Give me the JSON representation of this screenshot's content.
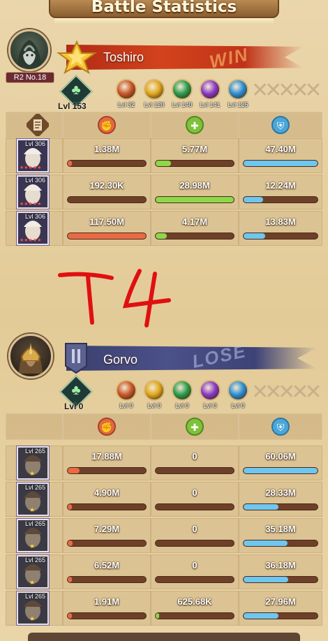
{
  "title": "Battle Statistics",
  "colors": {
    "damage": "#ea6a45",
    "heal": "#8cd84a",
    "defense": "#6fc6ee",
    "win_banner": "#c03218",
    "lose_banner": "#4b5189",
    "annotation": "#e01010"
  },
  "annotation": "T4",
  "teams": [
    {
      "player": "Toshiro",
      "rank": "R2 No.18",
      "result": "WIN",
      "level": "Lvl 153",
      "gems": [
        {
          "label": "Lvl 32",
          "color": "#c9582a",
          "icon": "fire-gem-icon"
        },
        {
          "label": "Lvl 120",
          "color": "#e1a81e",
          "icon": "shield-gem-icon"
        },
        {
          "label": "Lvl 140",
          "color": "#2e9b4c",
          "icon": "leaf-gem-icon"
        },
        {
          "label": "Lvl 141",
          "color": "#8a3bc4",
          "icon": "arcane-gem-icon"
        },
        {
          "label": "Lvl 125",
          "color": "#2f8fd2",
          "icon": "ice-gem-icon"
        }
      ],
      "heroes": [
        {
          "level": "Lvl 306",
          "stars": "★★★★★",
          "damage": "1.38M",
          "heal": "5.77M",
          "defense": "47.40M",
          "dmg_frac": 0.01,
          "heal_frac": 0.2,
          "def_frac": 1.0
        },
        {
          "level": "Lvl 306",
          "stars": "★★★★★",
          "damage": "192.30K",
          "heal": "28.98M",
          "defense": "12.24M",
          "dmg_frac": 0.0,
          "heal_frac": 1.0,
          "def_frac": 0.26
        },
        {
          "level": "Lvl 306",
          "stars": "★★★★★",
          "damage": "117.50M",
          "heal": "4.17M",
          "defense": "13.83M",
          "dmg_frac": 1.0,
          "heal_frac": 0.14,
          "def_frac": 0.29
        }
      ]
    },
    {
      "player": "Gorvo",
      "rank": "",
      "result": "LOSE",
      "level": "Lvl 0",
      "gems": [
        {
          "label": "Lvl 0",
          "color": "#c9582a",
          "icon": "fire-gem-icon"
        },
        {
          "label": "Lvl 0",
          "color": "#e1a81e",
          "icon": "shield-gem-icon"
        },
        {
          "label": "Lvl 0",
          "color": "#2e9b4c",
          "icon": "leaf-gem-icon"
        },
        {
          "label": "Lvl 0",
          "color": "#8a3bc4",
          "icon": "arcane-gem-icon"
        },
        {
          "label": "Lvl 0",
          "color": "#2f8fd2",
          "icon": "ice-gem-icon"
        }
      ],
      "heroes": [
        {
          "level": "Lvl 265",
          "stars": "★",
          "damage": "17.88M",
          "heal": "0",
          "defense": "60.06M",
          "dmg_frac": 0.15,
          "heal_frac": 0.0,
          "def_frac": 1.0
        },
        {
          "level": "Lvl 265",
          "stars": "★",
          "damage": "4.90M",
          "heal": "0",
          "defense": "28.33M",
          "dmg_frac": 0.04,
          "heal_frac": 0.0,
          "def_frac": 0.47
        },
        {
          "level": "Lvl 265",
          "stars": "★",
          "damage": "7.29M",
          "heal": "0",
          "defense": "35.18M",
          "dmg_frac": 0.06,
          "heal_frac": 0.0,
          "def_frac": 0.59
        },
        {
          "level": "Lvl 265",
          "stars": "★",
          "damage": "6.52M",
          "heal": "0",
          "defense": "36.18M",
          "dmg_frac": 0.05,
          "heal_frac": 0.0,
          "def_frac": 0.6
        },
        {
          "level": "Lvl 265",
          "stars": "★",
          "damage": "1.91M",
          "heal": "625.68K",
          "defense": "27.96M",
          "dmg_frac": 0.02,
          "heal_frac": 0.02,
          "def_frac": 0.47
        }
      ]
    }
  ]
}
